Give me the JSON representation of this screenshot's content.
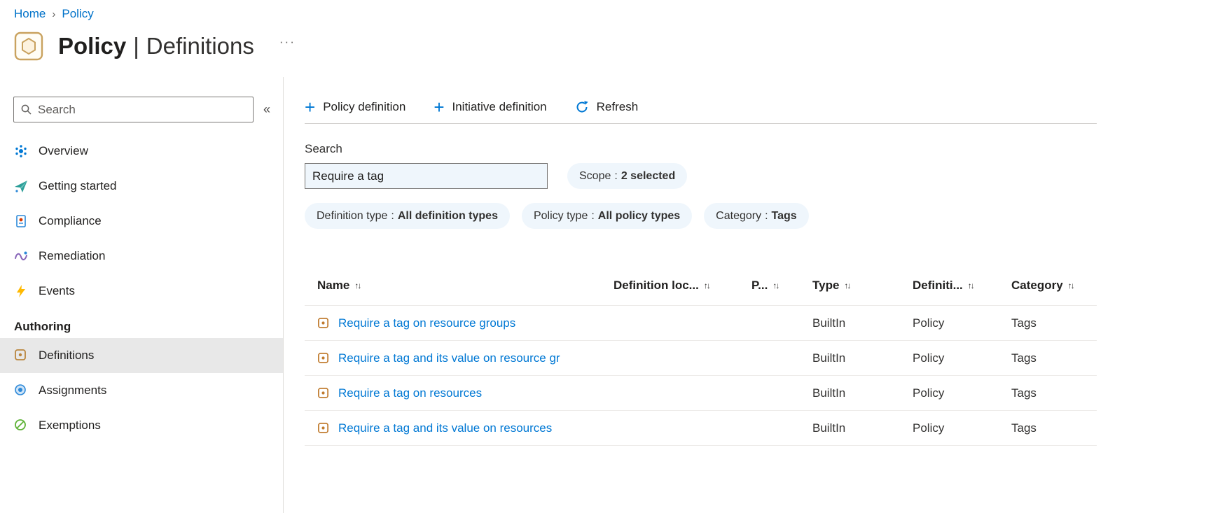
{
  "colors": {
    "accent": "#0078d4",
    "link": "#0078d4",
    "pill_background": "#eff6fc",
    "selected_nav_background": "#e8e8e8"
  },
  "breadcrumb": {
    "home": "Home",
    "separator": "›",
    "current": "Policy"
  },
  "page": {
    "title_primary": "Policy",
    "title_divider": "|",
    "title_secondary": "Definitions",
    "more": "···"
  },
  "sidebar": {
    "search": {
      "placeholder": "Search"
    },
    "collapse_glyph": "«",
    "items": [
      {
        "label": "Overview"
      },
      {
        "label": "Getting started"
      },
      {
        "label": "Compliance"
      },
      {
        "label": "Remediation"
      },
      {
        "label": "Events"
      }
    ],
    "section_label": "Authoring",
    "authoring": [
      {
        "label": "Definitions",
        "selected": true
      },
      {
        "label": "Assignments",
        "selected": false
      },
      {
        "label": "Exemptions",
        "selected": false
      }
    ]
  },
  "toolbar": {
    "plus_glyph": "+",
    "buttons": [
      {
        "label": "Policy definition"
      },
      {
        "label": "Initiative definition"
      },
      {
        "label": "Refresh"
      }
    ]
  },
  "filters": {
    "search_label": "Search",
    "search_value": "Require a tag",
    "pills": [
      {
        "name": "Scope",
        "separator": ":",
        "value": "2 selected"
      },
      {
        "name": "Definition type",
        "separator": ":",
        "value": "All definition types"
      },
      {
        "name": "Policy type",
        "separator": ":",
        "value": "All policy types"
      },
      {
        "name": "Category",
        "separator": ":",
        "value": "Tags"
      }
    ]
  },
  "table": {
    "sort_glyph": "↑↓",
    "headers": [
      {
        "label": "Name"
      },
      {
        "label": "Definition loc..."
      },
      {
        "label": "P..."
      },
      {
        "label": "Type"
      },
      {
        "label": "Definiti..."
      },
      {
        "label": "Category"
      }
    ],
    "rows": [
      {
        "name": "Require a tag on resource groups",
        "definition_location": "",
        "policies": "",
        "type": "BuiltIn",
        "definition_type": "Policy",
        "category": "Tags"
      },
      {
        "name": "Require a tag and its value on resource gr",
        "definition_location": "",
        "policies": "",
        "type": "BuiltIn",
        "definition_type": "Policy",
        "category": "Tags"
      },
      {
        "name": "Require a tag on resources",
        "definition_location": "",
        "policies": "",
        "type": "BuiltIn",
        "definition_type": "Policy",
        "category": "Tags"
      },
      {
        "name": "Require a tag and its value on resources",
        "definition_location": "",
        "policies": "",
        "type": "BuiltIn",
        "definition_type": "Policy",
        "category": "Tags"
      }
    ]
  }
}
